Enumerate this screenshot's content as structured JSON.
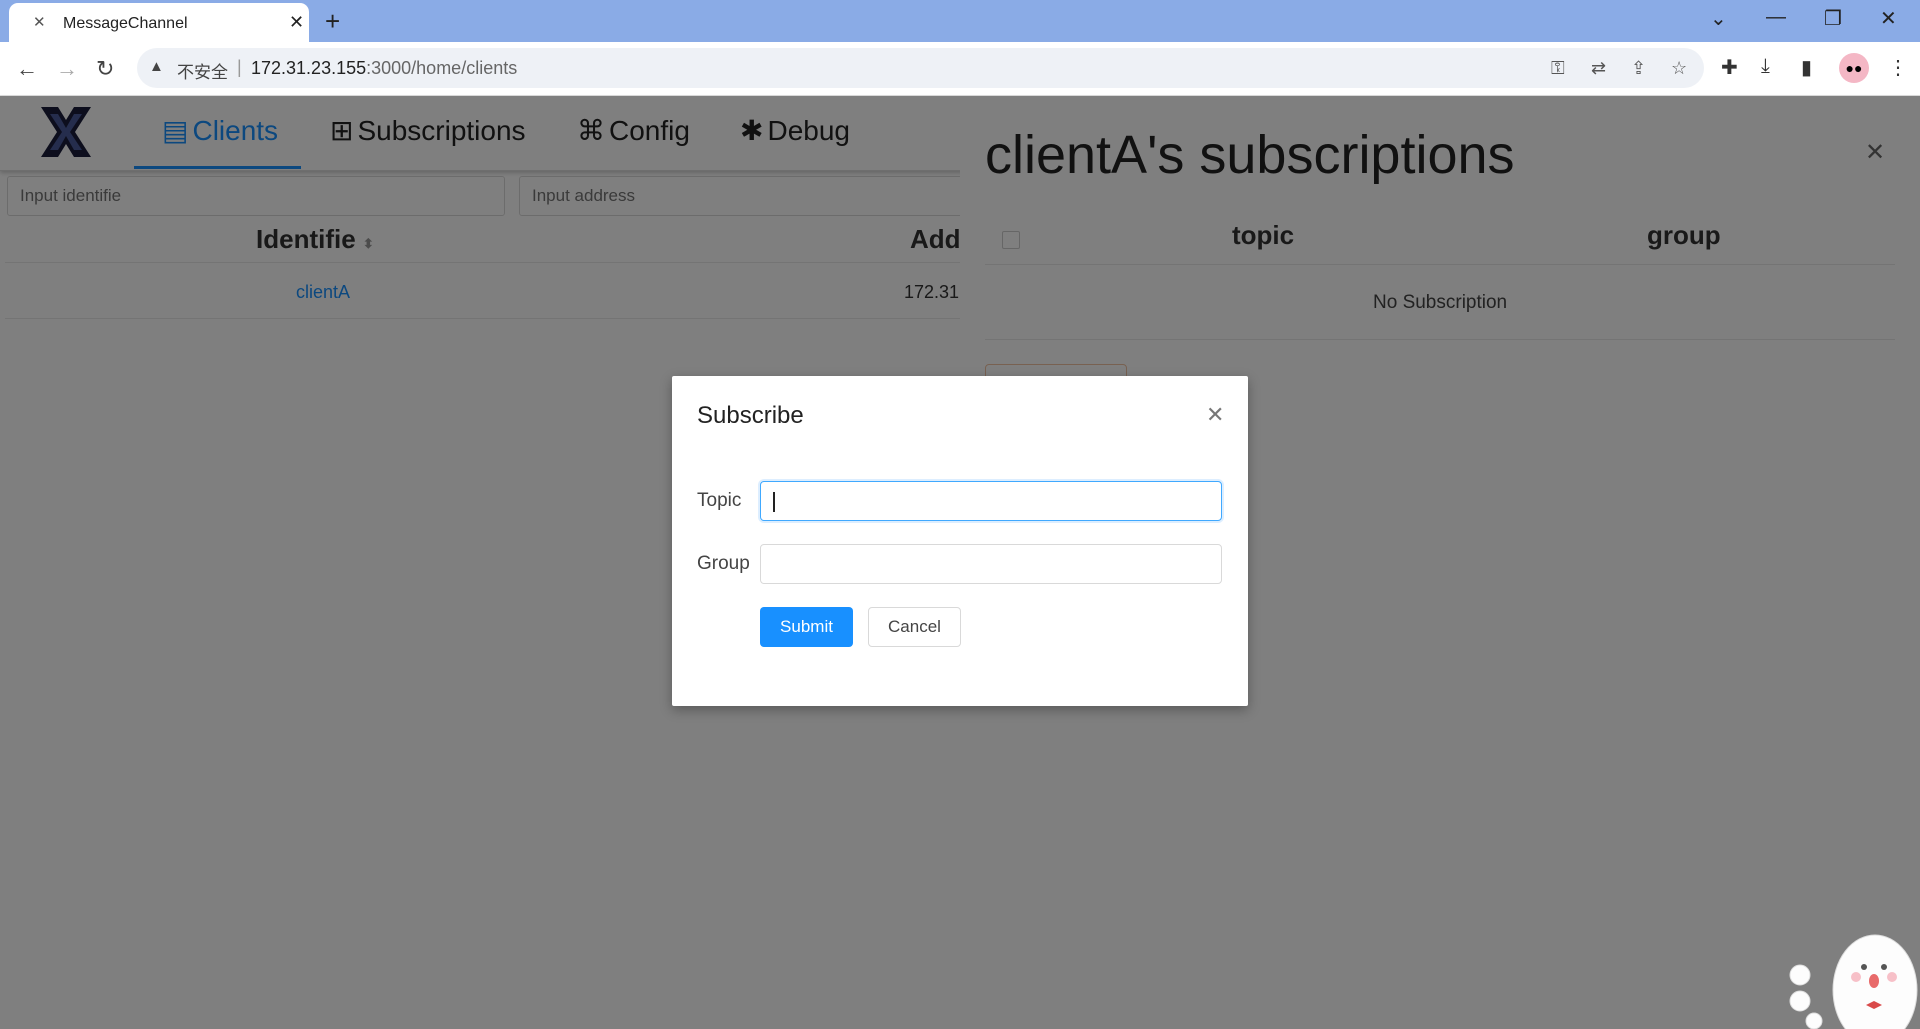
{
  "browser": {
    "tab_title": "MessageChannel",
    "security_label": "不安全",
    "url_host": "172.31.23.155",
    "url_rest": ":3000/home/clients"
  },
  "app": {
    "nav": [
      {
        "label": "Clients",
        "icon": "clients-icon",
        "active": true
      },
      {
        "label": "Subscriptions",
        "icon": "subscriptions-icon"
      },
      {
        "label": "Config",
        "icon": "config-icon"
      },
      {
        "label": "Debug",
        "icon": "bug-icon"
      }
    ],
    "filters": {
      "identifier_placeholder": "Input identifie",
      "address_placeholder": "Input address"
    },
    "table": {
      "columns": [
        "Identifie",
        "Add"
      ],
      "rows": [
        {
          "identifier": "clientA",
          "address": "172.31"
        }
      ]
    }
  },
  "drawer": {
    "title": "clientA's subscriptions",
    "columns": [
      "topic",
      "group"
    ],
    "empty_text": "No Subscription"
  },
  "modal": {
    "title": "Subscribe",
    "topic_label": "Topic",
    "topic_value": "",
    "group_label": "Group",
    "group_value": "",
    "submit_label": "Submit",
    "cancel_label": "Cancel"
  },
  "colors": {
    "accent": "#1890ff",
    "browser_bar": "#8aabe6"
  }
}
